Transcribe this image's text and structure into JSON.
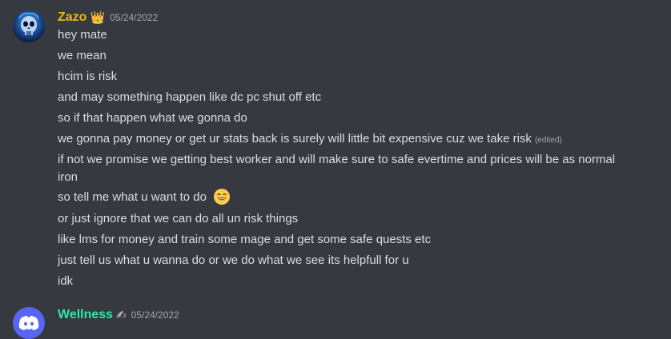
{
  "messages": [
    {
      "username": "Zazo",
      "badge": "👑",
      "timestamp": "05/24/2022",
      "lines": [
        "hey mate",
        "we mean",
        "hcim is risk",
        "and may something happen like dc pc shut off etc",
        "so if that happen what we gonna do",
        "we gonna pay money or get ur stats back is surely will little bit expensive cuz we take risk",
        "if not we promise we getting best worker and will make sure to safe evertime and prices will be as normal iron",
        "so tell me what u want to do",
        "or just ignore that we can do all un risk things",
        "like lms for money and train some mage and get some safe quests etc",
        "just tell us what u wanna do or we do what we see its helpfull for u",
        "idk"
      ],
      "edited_label": "(edited)",
      "emoji": "grinning-face-emoji"
    },
    {
      "username": "Wellness",
      "badge": "✍",
      "timestamp": "05/24/2022"
    }
  ],
  "colors": {
    "background": "#36393f",
    "zazo_name": "#e8b90f",
    "wellness_name": "#2ee6a8",
    "text": "#dcddde",
    "muted": "#a3a6aa",
    "wellness_avatar": "#5865f2"
  },
  "icons": {
    "zazo_avatar": "skull-avatar-icon",
    "wellness_avatar": "discord-logo-icon"
  }
}
